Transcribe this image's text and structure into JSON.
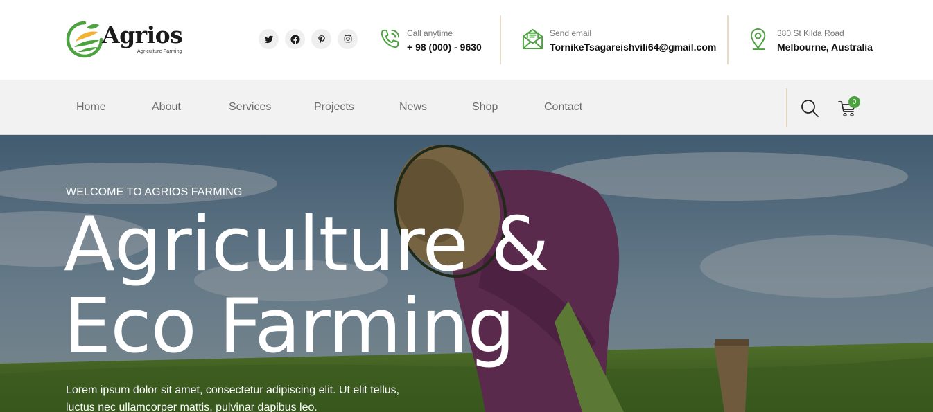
{
  "brand": {
    "name": "Agrios",
    "tagline": "Agriculture Farming",
    "accent_green": "#4ba23f",
    "accent_yellow": "#f2b233"
  },
  "social": [
    {
      "name": "twitter-icon"
    },
    {
      "name": "facebook-icon"
    },
    {
      "name": "pinterest-icon"
    },
    {
      "name": "instagram-icon"
    }
  ],
  "contacts": {
    "phone": {
      "label": "Call anytime",
      "value": "+ 98 (000) - 9630",
      "icon": "phone-icon"
    },
    "email": {
      "label": "Send email",
      "value": "TornikeTsagareishvili64@gmail.com",
      "icon": "envelope-icon"
    },
    "address": {
      "label": "380 St Kilda Road",
      "value": "Melbourne, Australia",
      "icon": "map-pin-icon"
    }
  },
  "nav": {
    "items": [
      "Home",
      "About",
      "Services",
      "Projects",
      "News",
      "Shop",
      "Contact"
    ],
    "cart_count": "0"
  },
  "hero": {
    "kicker": "WELCOME TO AGRIOS FARMING",
    "title_line1": "Agriculture &",
    "title_line2": "Eco Farming",
    "description": "Lorem ipsum dolor sit amet, consectetur adipiscing elit. Ut elit tellus, luctus nec ullamcorper mattis, pulvinar dapibus leo."
  }
}
